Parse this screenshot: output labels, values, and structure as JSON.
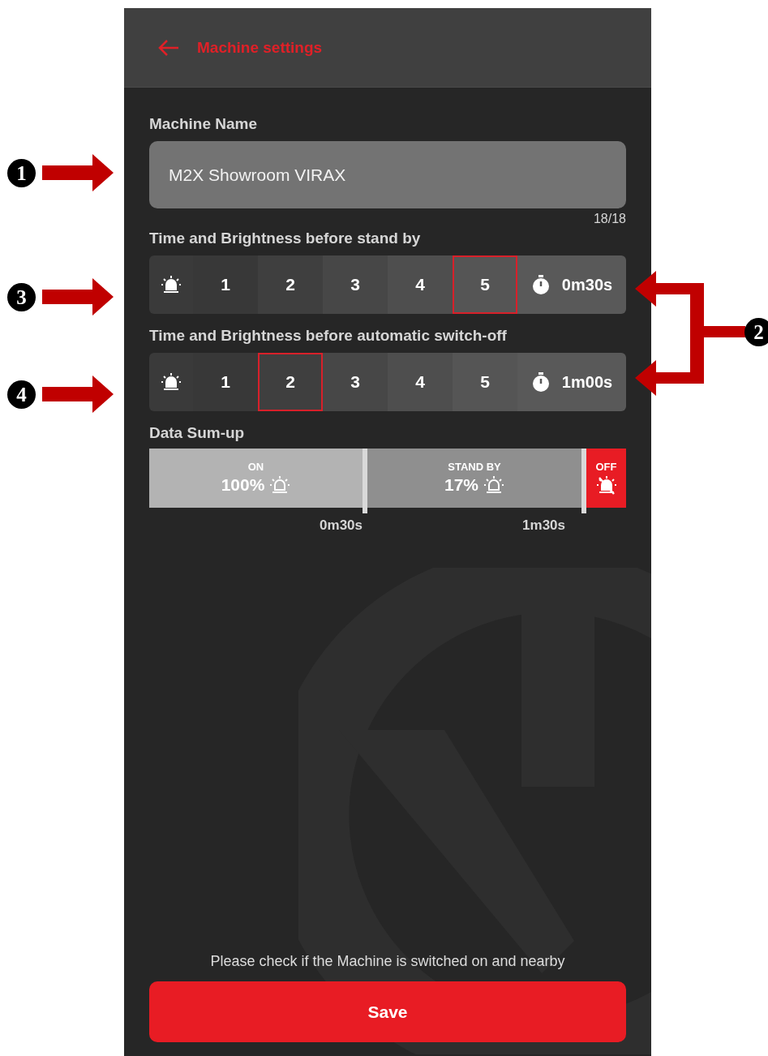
{
  "header": {
    "title": "Machine settings"
  },
  "machine_name": {
    "label": "Machine Name",
    "value": "M2X Showroom VIRAX",
    "counter": "18/18"
  },
  "brightness_rows": [
    {
      "label": "Time and Brightness before stand by",
      "options": [
        {
          "label": "1",
          "selected": false
        },
        {
          "label": "2",
          "selected": false
        },
        {
          "label": "3",
          "selected": false
        },
        {
          "label": "4",
          "selected": false
        },
        {
          "label": "5",
          "selected": true
        }
      ],
      "time": "0m30s"
    },
    {
      "label": "Time and Brightness before automatic switch-off",
      "options": [
        {
          "label": "1",
          "selected": false
        },
        {
          "label": "2",
          "selected": true
        },
        {
          "label": "3",
          "selected": false
        },
        {
          "label": "4",
          "selected": false
        },
        {
          "label": "5",
          "selected": false
        }
      ],
      "time": "1m00s"
    }
  ],
  "data_sum_up": {
    "label": "Data Sum-up",
    "segments": [
      {
        "kind": "on",
        "caption": "ON",
        "value": "100%",
        "end": "0m30s"
      },
      {
        "kind": "standby",
        "caption": "STAND BY",
        "value": "17%",
        "end": "1m30s"
      },
      {
        "kind": "off",
        "caption": "OFF"
      }
    ]
  },
  "message": "Please check if the Machine is switched on and nearby",
  "save_button": "Save",
  "annotations": [
    {
      "number": "1",
      "kind": "arrow"
    },
    {
      "number": "3",
      "kind": "arrow"
    },
    {
      "number": "4",
      "kind": "arrow"
    },
    {
      "number": "2",
      "kind": "bracket"
    }
  ]
}
